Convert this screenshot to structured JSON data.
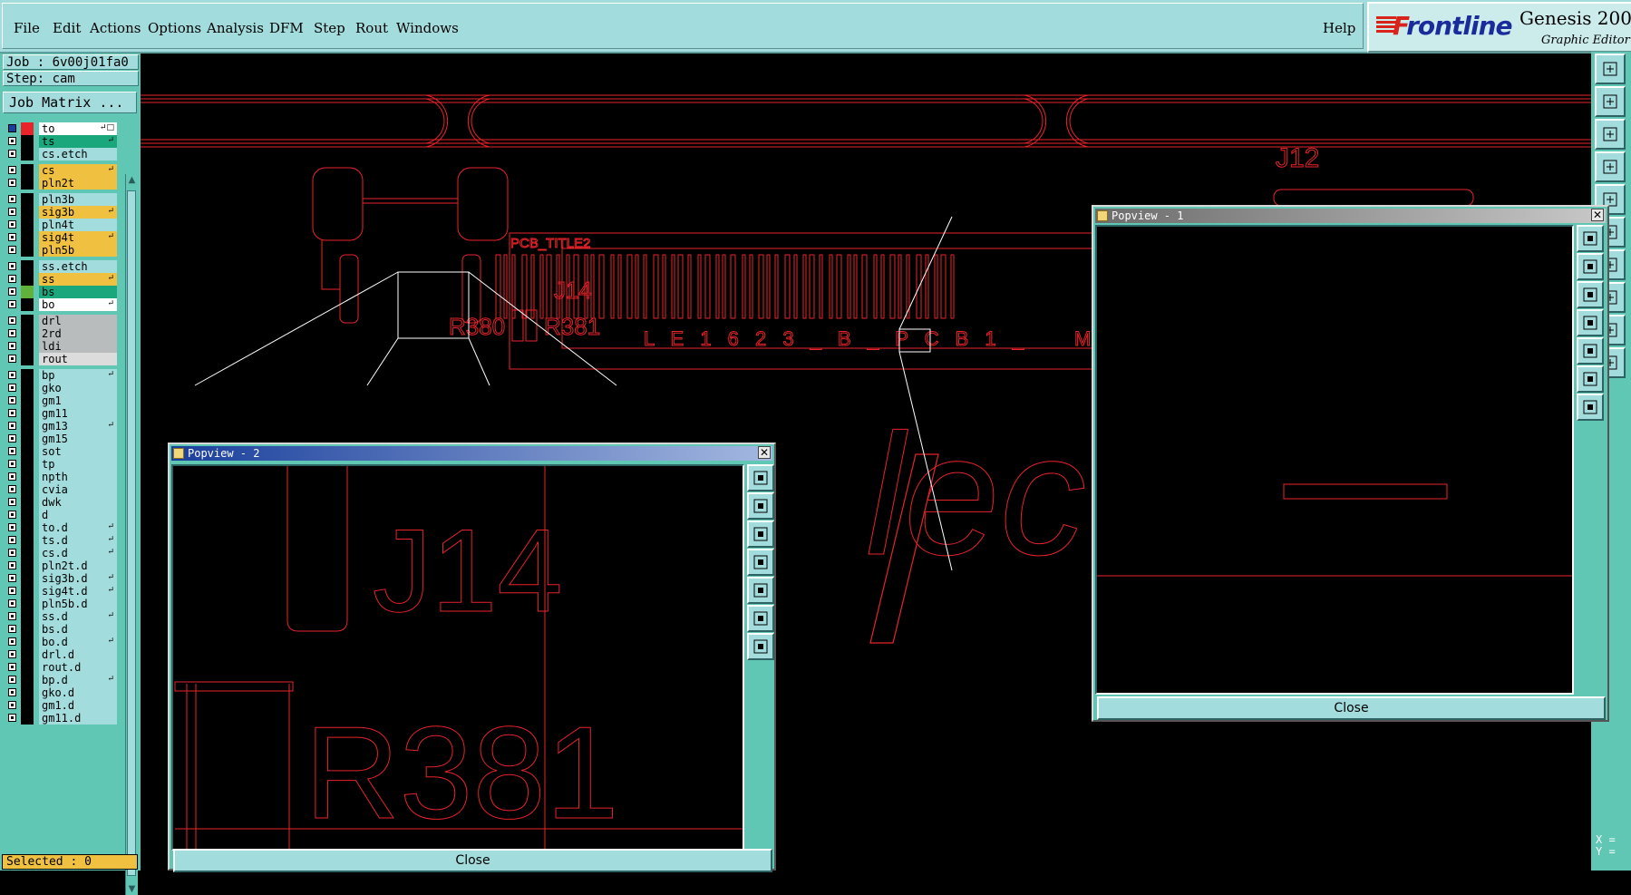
{
  "menu": {
    "items": [
      "File",
      "Edit",
      "Actions",
      "Options",
      "Analysis",
      "DFM",
      "Step",
      "Rout",
      "Windows"
    ],
    "help": "Help"
  },
  "logo": {
    "brand_f": "F",
    "brand_rest": "rontline",
    "product": "Genesis 200",
    "subtitle": "Graphic Editor"
  },
  "left": {
    "job": "Job : 6v00j01fa0",
    "step": "Step: cam",
    "matrix_button": "Job Matrix ...",
    "selected": "Selected : 0"
  },
  "layers": [
    {
      "name": "to",
      "color": "#ffffff",
      "sw": "#e8232a",
      "mark": "↵□"
    },
    {
      "name": "ts",
      "color": "#1aa77c",
      "sw": "#000000",
      "mark": "↵"
    },
    {
      "name": "cs.etch",
      "color": "#a3dcdc",
      "sw": "#000000",
      "mark": ""
    },
    {
      "name": "cs",
      "color": "#f0c040",
      "sw": "#000000",
      "mark": "↵"
    },
    {
      "name": "pln2t",
      "color": "#f0c040",
      "sw": "#000000",
      "mark": ""
    },
    {
      "name": "pln3b",
      "color": "#a3dcdc",
      "sw": "#000000",
      "mark": ""
    },
    {
      "name": "sig3b",
      "color": "#f0c040",
      "sw": "#000000",
      "mark": "↵"
    },
    {
      "name": "pln4t",
      "color": "#a3dcdc",
      "sw": "#000000",
      "mark": ""
    },
    {
      "name": "sig4t",
      "color": "#f0c040",
      "sw": "#000000",
      "mark": "↵"
    },
    {
      "name": "pln5b",
      "color": "#f0c040",
      "sw": "#000000",
      "mark": ""
    },
    {
      "name": "ss.etch",
      "color": "#a3dcdc",
      "sw": "#000000",
      "mark": ""
    },
    {
      "name": "ss",
      "color": "#f0c040",
      "sw": "#000000",
      "mark": "↵"
    },
    {
      "name": "bs",
      "color": "#1aa77c",
      "sw": "#61b23b",
      "mark": ""
    },
    {
      "name": "bo",
      "color": "#ffffff",
      "sw": "#000000",
      "mark": "↵"
    },
    {
      "name": "drl",
      "color": "#b8bcbc",
      "sw": "#000000",
      "mark": ""
    },
    {
      "name": "2rd",
      "color": "#b8bcbc",
      "sw": "#000000",
      "mark": ""
    },
    {
      "name": "ldi",
      "color": "#b8bcbc",
      "sw": "#000000",
      "mark": ""
    },
    {
      "name": "rout",
      "color": "#dcdcdc",
      "sw": "#000000",
      "mark": ""
    },
    {
      "name": "bp",
      "color": "#a3dcdc",
      "sw": "#000000",
      "mark": "↵"
    },
    {
      "name": "gko",
      "color": "#a3dcdc",
      "sw": "#000000",
      "mark": ""
    },
    {
      "name": "gm1",
      "color": "#a3dcdc",
      "sw": "#000000",
      "mark": ""
    },
    {
      "name": "gm11",
      "color": "#a3dcdc",
      "sw": "#000000",
      "mark": ""
    },
    {
      "name": "gm13",
      "color": "#a3dcdc",
      "sw": "#000000",
      "mark": "↵"
    },
    {
      "name": "gm15",
      "color": "#a3dcdc",
      "sw": "#000000",
      "mark": ""
    },
    {
      "name": "sot",
      "color": "#a3dcdc",
      "sw": "#000000",
      "mark": ""
    },
    {
      "name": "tp",
      "color": "#a3dcdc",
      "sw": "#000000",
      "mark": ""
    },
    {
      "name": "npth",
      "color": "#a3dcdc",
      "sw": "#000000",
      "mark": ""
    },
    {
      "name": "cvia",
      "color": "#a3dcdc",
      "sw": "#000000",
      "mark": ""
    },
    {
      "name": "dwk",
      "color": "#a3dcdc",
      "sw": "#000000",
      "mark": ""
    },
    {
      "name": "d",
      "color": "#a3dcdc",
      "sw": "#000000",
      "mark": ""
    },
    {
      "name": "to.d",
      "color": "#a3dcdc",
      "sw": "#000000",
      "mark": "↵"
    },
    {
      "name": "ts.d",
      "color": "#a3dcdc",
      "sw": "#000000",
      "mark": "↵"
    },
    {
      "name": "cs.d",
      "color": "#a3dcdc",
      "sw": "#000000",
      "mark": "↵"
    },
    {
      "name": "pln2t.d",
      "color": "#a3dcdc",
      "sw": "#000000",
      "mark": ""
    },
    {
      "name": "sig3b.d",
      "color": "#a3dcdc",
      "sw": "#000000",
      "mark": "↵"
    },
    {
      "name": "sig4t.d",
      "color": "#a3dcdc",
      "sw": "#000000",
      "mark": "↵"
    },
    {
      "name": "pln5b.d",
      "color": "#a3dcdc",
      "sw": "#000000",
      "mark": ""
    },
    {
      "name": "ss.d",
      "color": "#a3dcdc",
      "sw": "#000000",
      "mark": "↵"
    },
    {
      "name": "bs.d",
      "color": "#a3dcdc",
      "sw": "#000000",
      "mark": ""
    },
    {
      "name": "bo.d",
      "color": "#a3dcdc",
      "sw": "#000000",
      "mark": "↵"
    },
    {
      "name": "drl.d",
      "color": "#a3dcdc",
      "sw": "#000000",
      "mark": ""
    },
    {
      "name": "rout.d",
      "color": "#a3dcdc",
      "sw": "#000000",
      "mark": ""
    },
    {
      "name": "bp.d",
      "color": "#a3dcdc",
      "sw": "#000000",
      "mark": "↵"
    },
    {
      "name": "gko.d",
      "color": "#a3dcdc",
      "sw": "#000000",
      "mark": ""
    },
    {
      "name": "gm1.d",
      "color": "#a3dcdc",
      "sw": "#000000",
      "mark": ""
    },
    {
      "name": "gm11.d",
      "color": "#a3dcdc",
      "sw": "#000000",
      "mark": ""
    }
  ],
  "canvas": {
    "j12": "J12",
    "j14": "J14",
    "r380": "R380",
    "r381": "R381",
    "pcb_title": "PCB_TITLE2",
    "barcode_text": "L E 1 6 2 3 _ B _ P C B 1 _",
    "barcode_end": "M",
    "logo_text": "lec"
  },
  "popview2": {
    "title": "Popview - 2",
    "close": "Close",
    "j_text": "J14",
    "r_text": "R381"
  },
  "popview1": {
    "title": "Popview - 1",
    "close": "Close"
  },
  "coords": {
    "x": "X =",
    "y": "Y ="
  },
  "icons": {
    "right_toolbar": [
      "zoom-window-icon",
      "pan-icon",
      "fit-icon",
      "measure-icon",
      "snap-icon",
      "layer-color-icon",
      "line-icon",
      "pad-icon",
      "triangle-icon",
      "pointer-icon"
    ]
  }
}
